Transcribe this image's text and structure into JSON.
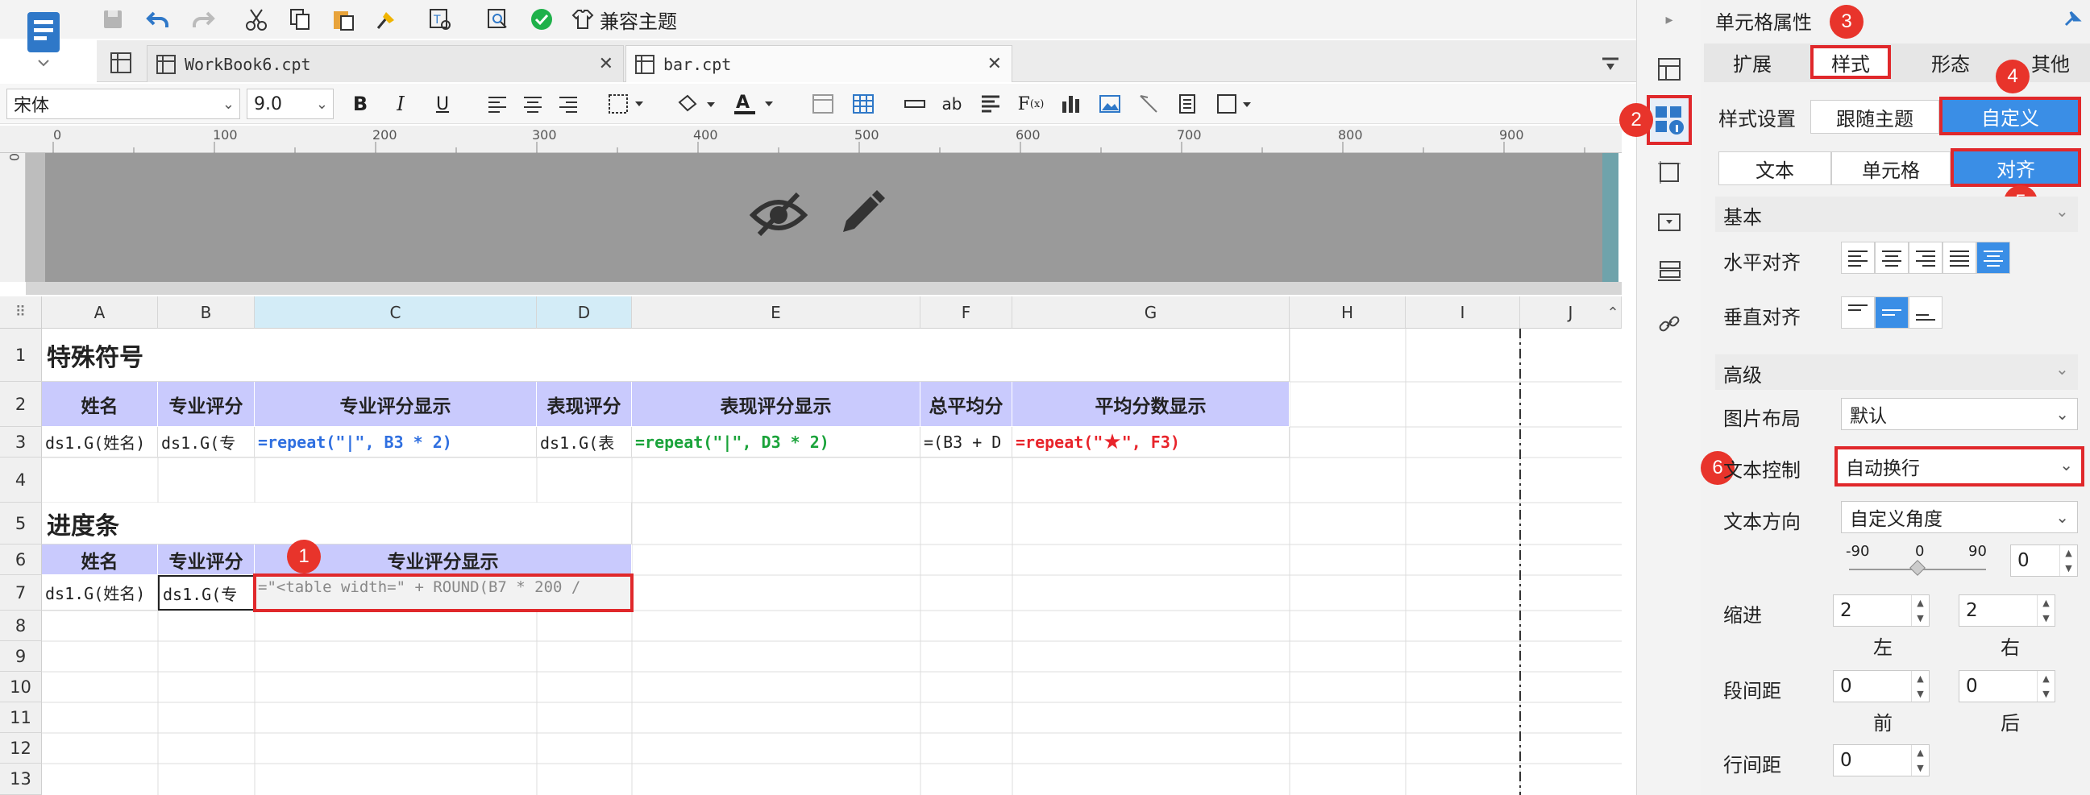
{
  "toolbar": {
    "compat_theme_label": "兼容主题",
    "font_name": "宋体",
    "font_size": "9.0"
  },
  "tabs": [
    {
      "label": "WorkBook6.cpt"
    },
    {
      "label": "bar.cpt"
    }
  ],
  "ruler": {
    "ticks": [
      "0",
      "100",
      "200",
      "300",
      "400",
      "500",
      "600",
      "700",
      "800",
      "900"
    ],
    "vertical_zero": "0"
  },
  "grid": {
    "columns": [
      "A",
      "B",
      "C",
      "D",
      "E",
      "F",
      "G",
      "H",
      "I",
      "J"
    ],
    "rows": [
      "1",
      "2",
      "3",
      "4",
      "5",
      "6",
      "7",
      "8",
      "9",
      "10",
      "11",
      "12",
      "13"
    ],
    "section1_title": "特殊符号",
    "headers1": [
      "姓名",
      "专业评分",
      "专业评分显示",
      "表现评分",
      "表现评分显示",
      "总平均分",
      "平均分数显示"
    ],
    "row3": {
      "a": "ds1.G(姓名)",
      "b": "ds1.G(专",
      "c": "=repeat(\"|\", B3 * 2)",
      "d": "ds1.G(表",
      "e": "=repeat(\"|\", D3 * 2)",
      "f": "=(B3 + D",
      "g_prefix": "=repeat(\"",
      "g_star": "★",
      "g_suffix": "\", F3)"
    },
    "section2_title": "进度条",
    "headers2": [
      "姓名",
      "专业评分",
      "专业评分显示"
    ],
    "row7": {
      "a": "ds1.G(姓名)",
      "b": "ds1.G(专",
      "c": "=\"<table width=\" + ROUND(B7 * 200 /"
    }
  },
  "panel": {
    "title": "单元格属性",
    "tabs": [
      "扩展",
      "样式",
      "形态",
      "其他"
    ],
    "active_tab": "样式",
    "style_setting_label": "样式设置",
    "style_options": [
      "跟随主题",
      "自定义"
    ],
    "sub_tabs": [
      "文本",
      "单元格",
      "对齐"
    ],
    "basic_section": "基本",
    "h_align_label": "水平对齐",
    "v_align_label": "垂直对齐",
    "advanced_section": "高级",
    "image_layout_label": "图片布局",
    "image_layout_value": "默认",
    "text_control_label": "文本控制",
    "text_control_value": "自动换行",
    "text_direction_label": "文本方向",
    "text_direction_value": "自定义角度",
    "angle_min": "-90",
    "angle_mid": "0",
    "angle_max": "90",
    "angle_value": "0",
    "indent_label": "缩进",
    "indent_left": "2",
    "indent_right": "2",
    "left_label": "左",
    "right_label": "右",
    "para_spacing_label": "段间距",
    "para_before": "0",
    "para_after": "0",
    "before_label": "前",
    "after_label": "后",
    "line_spacing_label": "行间距",
    "line_spacing": "0"
  },
  "badges": [
    "1",
    "2",
    "3",
    "4",
    "5",
    "6"
  ],
  "colors": {
    "accent": "#3a8ee6",
    "annotation": "#e0282b",
    "header_fill": "#c9cafd"
  }
}
